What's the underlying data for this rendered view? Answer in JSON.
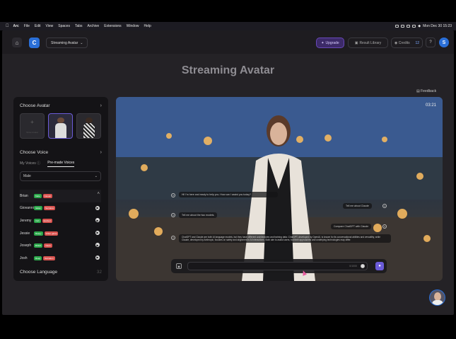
{
  "menubar": {
    "items": [
      "Arc",
      "File",
      "Edit",
      "View",
      "Spaces",
      "Tabs",
      "Archive",
      "Extensions",
      "Window",
      "Help"
    ],
    "clock": "Mon Dec 30  15:23"
  },
  "nav": {
    "logo": "C",
    "project": "Streaming Avatar",
    "upgrade": "Upgrade",
    "library": "Result Library",
    "credits_label": "Credits",
    "credits_value": "12",
    "help": "?",
    "user_initial": "S"
  },
  "page_title": "Streaming Avatar",
  "sidebar": {
    "choose_avatar": "Choose Avatar",
    "add_label": "Show Avatar",
    "choose_voice": "Choose Voice",
    "tabs": [
      "My Voices",
      "Pre-made Voices"
    ],
    "gender_select": "Male",
    "voices": [
      {
        "name": "Brian",
        "tags": [
          {
            "t": "Male",
            "c": "g"
          },
          {
            "t": "Casual",
            "c": "r"
          }
        ]
      },
      {
        "name": "Giovanni",
        "tags": [
          {
            "t": "Italian",
            "c": "g"
          },
          {
            "t": "Narrative",
            "c": "r"
          }
        ]
      },
      {
        "name": "Jeremy",
        "tags": [
          {
            "t": "Irish",
            "c": "g"
          },
          {
            "t": "Excited",
            "c": "r"
          }
        ]
      },
      {
        "name": "Jessie",
        "tags": [
          {
            "t": "Raspy",
            "c": "g"
          },
          {
            "t": "Video game",
            "c": "r"
          }
        ]
      },
      {
        "name": "Joseph",
        "tags": [
          {
            "t": "British",
            "c": "g"
          },
          {
            "t": "News",
            "c": "r"
          }
        ]
      },
      {
        "name": "Josh",
        "tags": [
          {
            "t": "Deep",
            "c": "g"
          },
          {
            "t": "Narration",
            "c": "r"
          }
        ]
      }
    ],
    "choose_language": "Choose Language",
    "language_count": "32"
  },
  "feedback": "Feedback",
  "video": {
    "timer": "03:21",
    "messages": [
      {
        "text": "Hi! I'm here and ready to help you. How can I assist you today?",
        "side": "left"
      },
      {
        "text": "Tell me about Claude",
        "side": "right"
      },
      {
        "text": "Tell me about the two models.",
        "side": "left"
      },
      {
        "text": "Compare ChatGPT with Claude",
        "side": "right"
      },
      {
        "text": "ChatGPT and Claude are both AI language models, but they have different architectures and training data. ChatGPT, developed by OpenAI, is known for its conversational abilities and versatility, while Claude, developed by Anthropic, focuses on safety and alignment in AI interactions. Both aim to assist users, but their approaches and underlying technologies may differ.",
        "side": "left"
      }
    ],
    "input_counter": "0/1000"
  }
}
